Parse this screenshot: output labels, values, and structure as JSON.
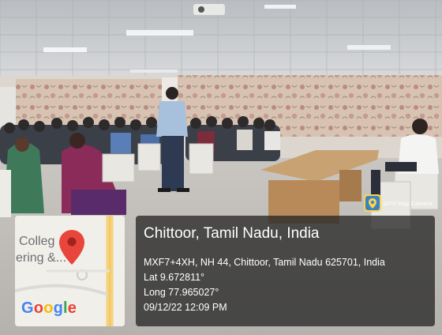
{
  "map_card": {
    "map_text_line1": "Colleg",
    "map_text_line2": "ering &...",
    "google_logo": [
      {
        "char": "G",
        "color": "#4285F4"
      },
      {
        "char": "o",
        "color": "#EA4335"
      },
      {
        "char": "o",
        "color": "#FBBC05"
      },
      {
        "char": "g",
        "color": "#4285F4"
      },
      {
        "char": "l",
        "color": "#34A853"
      },
      {
        "char": "e",
        "color": "#EA4335"
      }
    ],
    "pin_color": "#e8453c"
  },
  "gps_badge": {
    "label": "GPS Map Camera",
    "icon": "gps-map-camera-icon"
  },
  "location": {
    "title": "Chittoor, Tamil Nadu, India",
    "address": "MXF7+4XH, NH 44, Chittoor, Tamil Nadu 625701, India",
    "latitude": "Lat 9.672811°",
    "longitude": "Long 77.965027°",
    "datetime": "09/12/22 12:09 PM"
  }
}
